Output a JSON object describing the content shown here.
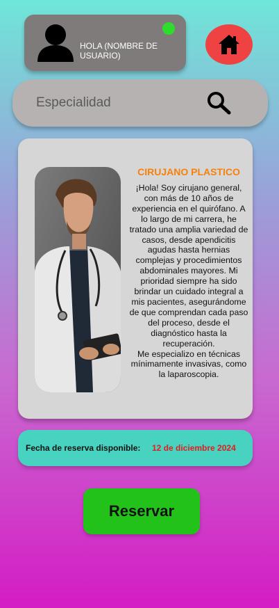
{
  "header": {
    "greeting": "HOLA (NOMBRE DE USUARIO)",
    "status_color": "#2ddc2d",
    "avatar_icon": "user-icon",
    "home_icon": "home-icon",
    "home_color": "#ef4343"
  },
  "search": {
    "placeholder": "Especialidad",
    "icon": "search-icon"
  },
  "doctor": {
    "specialty": "CIRUJANO PLASTICO",
    "bio": "¡Hola! Soy cirujano general, con más de 10 años de experiencia en el quirófano. A lo largo de mi carrera, he tratado una amplia variedad de casos, desde apendicitis agudas hasta hernias complejas y procedimientos abdominales mayores. Mi prioridad siempre ha sido brindar un cuidado integral a mis pacientes, asegurándome de que comprendan cada paso del proceso, desde el diagnóstico hasta la recuperación.\nMe especializo en técnicas mínimamente invasivas, como la laparoscopia."
  },
  "reservation": {
    "label": "Fecha de reserva disponible:",
    "date": "12 de diciembre 2024",
    "button_label": "Reservar"
  }
}
